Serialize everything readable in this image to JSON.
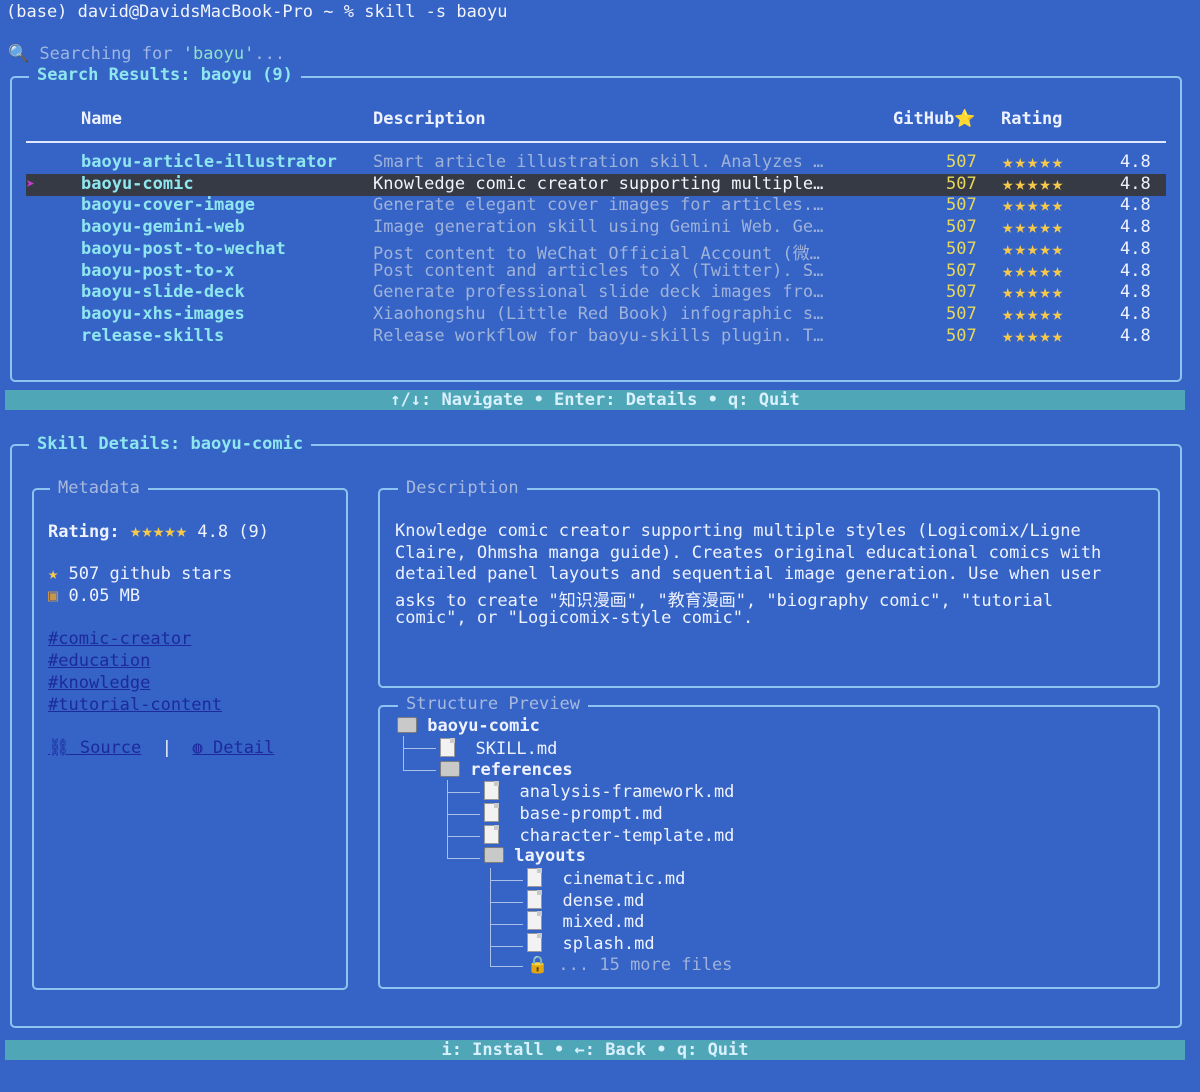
{
  "terminal": {
    "command": "(base) david@DavidsMacBook-Pro ~ % skill -s baoyu",
    "searching_prefix": "Searching for ",
    "searching_query": "'baoyu'",
    "searching_suffix": "...",
    "search_icon": "magnifier-icon"
  },
  "results": {
    "title": "Search Results: baoyu (9)",
    "columns": {
      "name": "Name",
      "description": "Description",
      "github": "GitHub⭐",
      "rating": "Rating"
    },
    "selected_index": 1,
    "rows": [
      {
        "name": "baoyu-article-illustrator",
        "description": "Smart article illustration skill. Analyzes …",
        "github": "507",
        "stars": "★★★★★",
        "rating": "4.8"
      },
      {
        "name": "baoyu-comic",
        "description": "Knowledge comic creator supporting multiple…",
        "github": "507",
        "stars": "★★★★★",
        "rating": "4.8"
      },
      {
        "name": "baoyu-cover-image",
        "description": "Generate elegant cover images for articles.…",
        "github": "507",
        "stars": "★★★★★",
        "rating": "4.8"
      },
      {
        "name": "baoyu-gemini-web",
        "description": "Image generation skill using Gemini Web. Ge…",
        "github": "507",
        "stars": "★★★★★",
        "rating": "4.8"
      },
      {
        "name": "baoyu-post-to-wechat",
        "description": "Post content to WeChat Official Account (微…",
        "github": "507",
        "stars": "★★★★★",
        "rating": "4.8"
      },
      {
        "name": "baoyu-post-to-x",
        "description": "Post content and articles to X (Twitter). S…",
        "github": "507",
        "stars": "★★★★★",
        "rating": "4.8"
      },
      {
        "name": "baoyu-slide-deck",
        "description": "Generate professional slide deck images fro…",
        "github": "507",
        "stars": "★★★★★",
        "rating": "4.8"
      },
      {
        "name": "baoyu-xhs-images",
        "description": "Xiaohongshu (Little Red Book) infographic s…",
        "github": "507",
        "stars": "★★★★★",
        "rating": "4.8"
      },
      {
        "name": "release-skills",
        "description": "Release workflow for baoyu-skills plugin. T…",
        "github": "507",
        "stars": "★★★★★",
        "rating": "4.8"
      }
    ]
  },
  "nav_bar": "↑/↓: Navigate • Enter: Details • q: Quit",
  "details": {
    "title": "Skill Details: baoyu-comic",
    "metadata": {
      "title": "Metadata",
      "rating_label": "Rating:",
      "rating_stars": "★★★★★",
      "rating_value": "4.8 (9)",
      "stars_line": "507 github stars",
      "size_line": "0.05 MB",
      "tags": [
        "#comic-creator",
        "#education",
        "#knowledge",
        "#tutorial-content"
      ],
      "source_link": "Source",
      "separator": "|",
      "detail_link": "Detail"
    },
    "description": {
      "title": "Description",
      "lines": [
        "Knowledge comic creator supporting multiple styles (Logicomix/Ligne",
        "Claire, Ohmsha manga guide). Creates original educational comics with",
        "detailed panel layouts and sequential image generation. Use when user",
        "asks to create \"知识漫画\", \"教育漫画\", \"biography comic\", \"tutorial",
        "comic\", or \"Logicomix-style comic\"."
      ]
    },
    "structure": {
      "title": "Structure Preview",
      "root": "baoyu-comic",
      "skill_file": "SKILL.md",
      "references": "references",
      "ref_files": [
        "analysis-framework.md",
        "base-prompt.md",
        "character-template.md"
      ],
      "layouts": "layouts",
      "layout_files": [
        "cinematic.md",
        "dense.md",
        "mixed.md",
        "splash.md"
      ],
      "more": "... 15 more files"
    }
  },
  "footer_bar": "i: Install • ←: Back • q: Quit"
}
